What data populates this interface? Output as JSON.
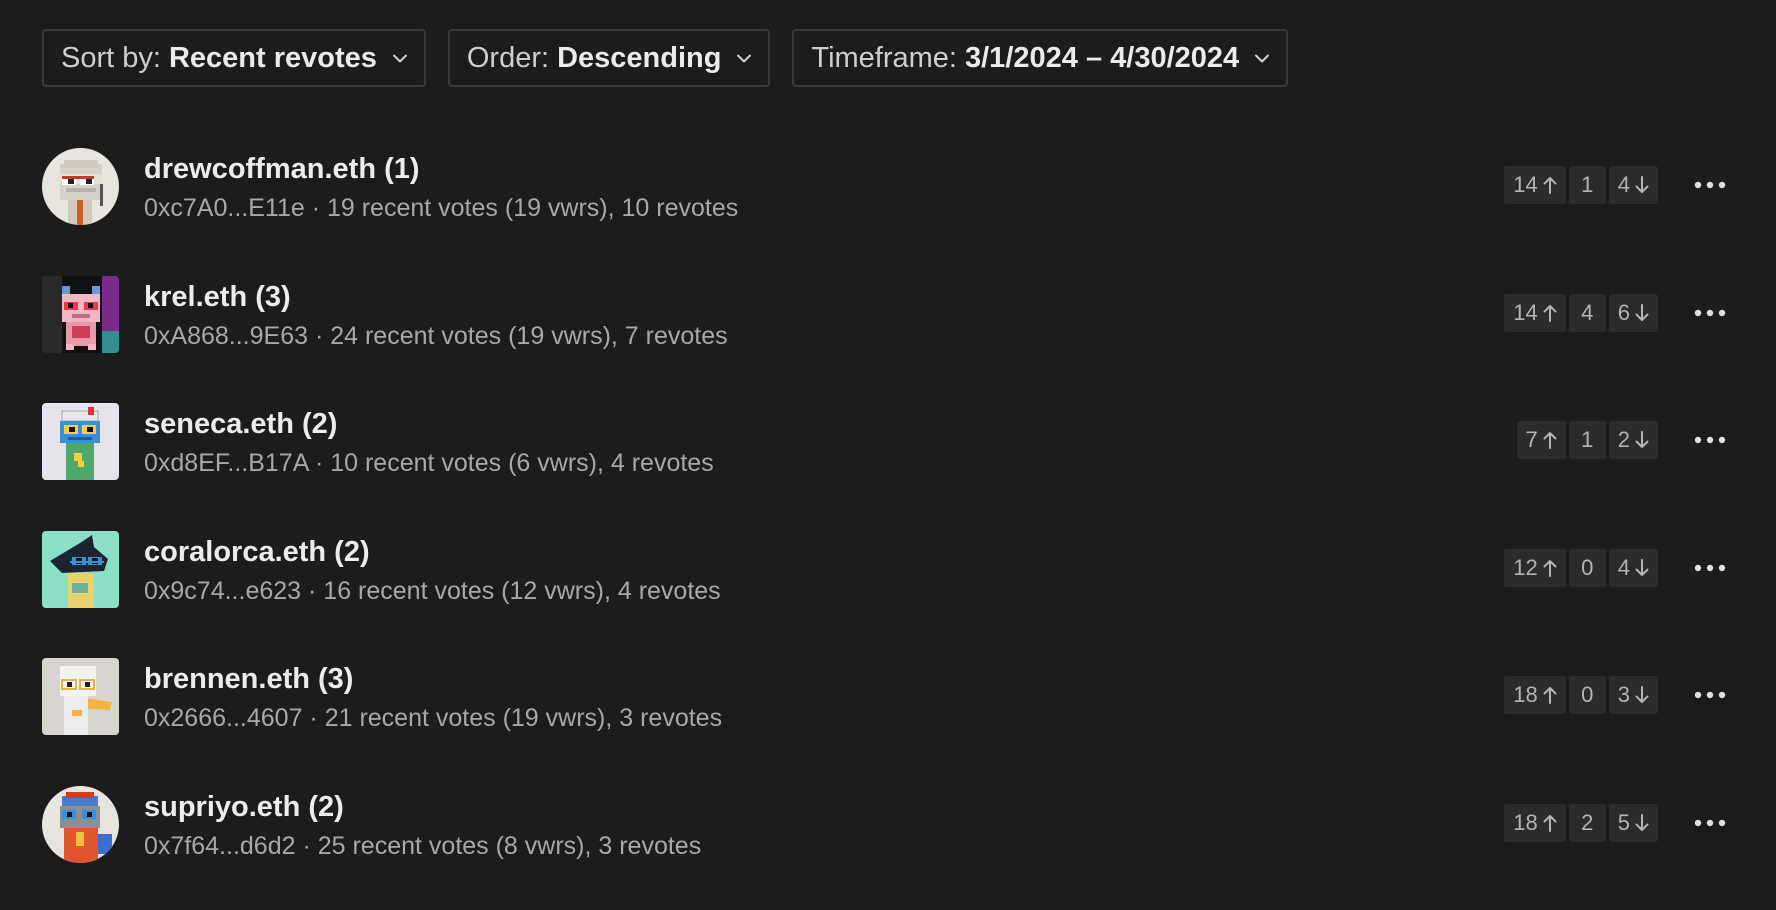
{
  "filters": {
    "sort": {
      "label": "Sort by:",
      "value": "Recent revotes",
      "icon": "chevron-down-icon"
    },
    "order": {
      "label": "Order:",
      "value": "Descending",
      "icon": "chevron-down-icon"
    },
    "timeframe": {
      "label": "Timeframe:",
      "value": "3/1/2024 – 4/30/2024",
      "icon": "chevron-down-icon"
    }
  },
  "voters": [
    {
      "name": "drewcoffman.eth (1)",
      "meta": "0xc7A0...E11e · 19 recent votes (19 vwrs), 10 revotes",
      "votes_for": "14",
      "votes_abstain": "1",
      "votes_against": "4",
      "avatar_icon": "noun-avatar-icon"
    },
    {
      "name": "krel.eth (3)",
      "meta": "0xA868...9E63 · 24 recent votes (19 vwrs), 7 revotes",
      "votes_for": "14",
      "votes_abstain": "4",
      "votes_against": "6",
      "avatar_icon": "noun-avatar-icon"
    },
    {
      "name": "seneca.eth (2)",
      "meta": "0xd8EF...B17A · 10 recent votes (6 vwrs), 4 revotes",
      "votes_for": "7",
      "votes_abstain": "1",
      "votes_against": "2",
      "avatar_icon": "noun-avatar-icon"
    },
    {
      "name": "coralorca.eth (2)",
      "meta": "0x9c74...e623 · 16 recent votes (12 vwrs), 4 revotes",
      "votes_for": "12",
      "votes_abstain": "0",
      "votes_against": "4",
      "avatar_icon": "noun-avatar-icon"
    },
    {
      "name": "brennen.eth (3)",
      "meta": "0x2666...4607 · 21 recent votes (19 vwrs), 3 revotes",
      "votes_for": "18",
      "votes_abstain": "0",
      "votes_against": "3",
      "avatar_icon": "noun-avatar-icon"
    },
    {
      "name": "supriyo.eth (2)",
      "meta": "0x7f64...d6d2 · 25 recent votes (8 vwrs), 3 revotes",
      "votes_for": "18",
      "votes_abstain": "2",
      "votes_against": "5",
      "avatar_icon": "noun-avatar-icon"
    }
  ],
  "row_actions_icon": "more-horizontal-icon",
  "vote_icons": {
    "for": "arrow-up-icon",
    "against": "arrow-down-icon"
  }
}
